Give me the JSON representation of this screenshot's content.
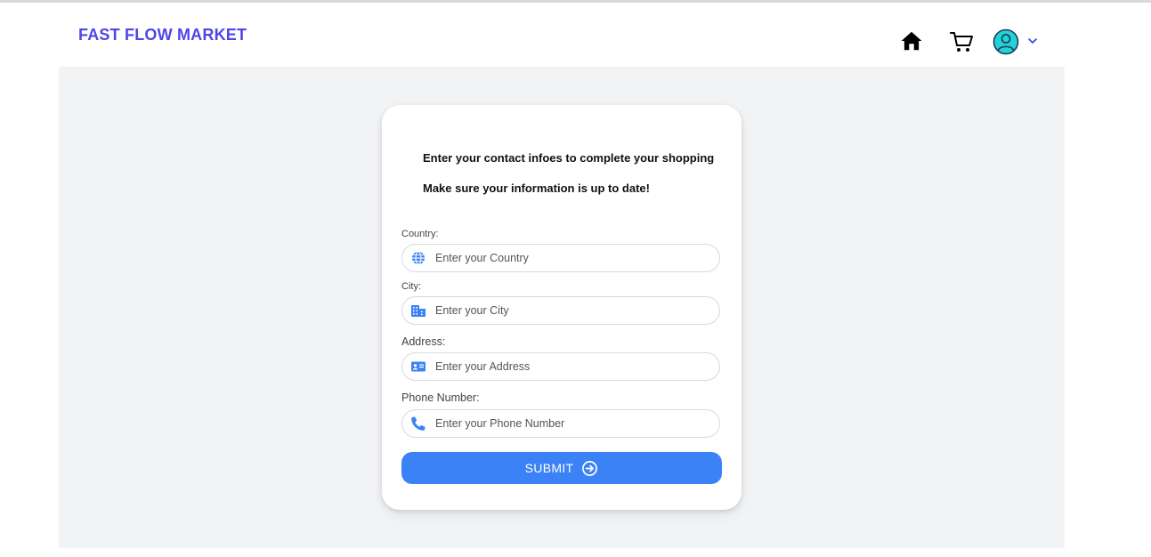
{
  "header": {
    "brand": "FAST FLOW MARKET",
    "icons": [
      "home-icon",
      "cart-icon",
      "user-avatar-icon",
      "chevron-down-icon"
    ]
  },
  "form": {
    "heading": "Enter your contact infoes to complete your shopping",
    "subheading": "Make sure your information is up to date!",
    "fields": [
      {
        "label": "Country:",
        "placeholder": "Enter your Country",
        "value": "",
        "icon": "globe-icon"
      },
      {
        "label": "City:",
        "placeholder": "Enter your City",
        "value": "",
        "icon": "city-icon"
      },
      {
        "label": "Address:",
        "placeholder": "Enter your Address",
        "value": "",
        "icon": "address-card-icon"
      },
      {
        "label": "Phone Number:",
        "placeholder": "Enter your Phone Number",
        "value": "",
        "icon": "phone-icon"
      }
    ],
    "submit_label": "SUBMIT"
  },
  "colors": {
    "brand": "#4f46e5",
    "accent": "#3b82f6",
    "background": "#f2f3f5",
    "avatar": "#22d3d3"
  }
}
